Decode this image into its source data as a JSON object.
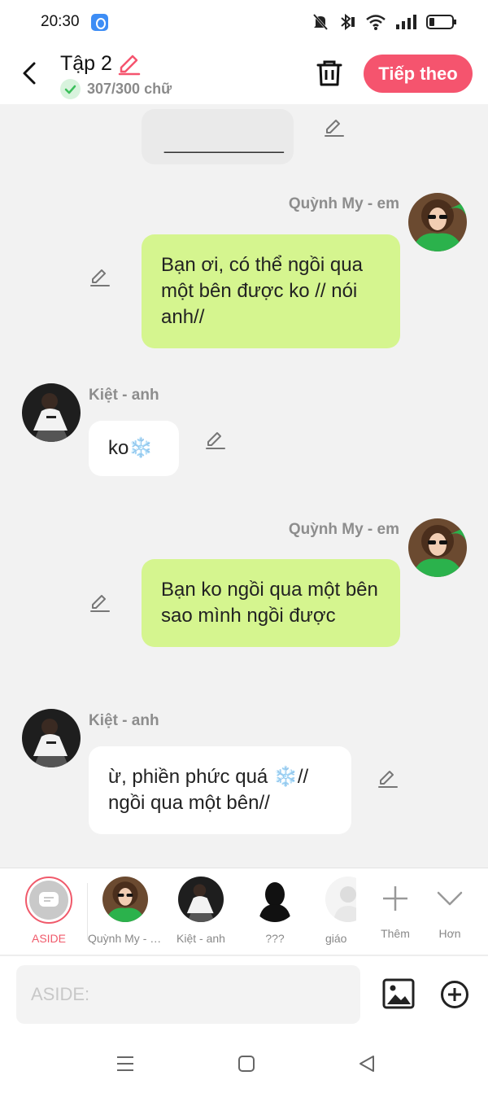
{
  "status_bar": {
    "time": "20:30"
  },
  "header": {
    "title": "Tập 2",
    "word_count": "307/300 chữ",
    "next_label": "Tiếp theo"
  },
  "messages": [
    {
      "side": "left",
      "text": "___________"
    },
    {
      "side": "right",
      "sender": "Quỳnh My - em",
      "text": "Bạn ơi, có thể ngồi qua một bên được ko // nói anh//"
    },
    {
      "side": "left",
      "sender": "Kiệt - anh",
      "text": "ko",
      "emoji": "❄️"
    },
    {
      "side": "right",
      "sender": "Quỳnh My - em",
      "text": "Bạn ko ngồi qua một bên sao mình ngồi được"
    },
    {
      "side": "left",
      "sender": "Kiệt - anh",
      "text_before_emoji": "ừ, phiền phức quá ",
      "emoji": "❄️",
      "text_after_emoji": "//",
      "text_line2": "ngồi qua một bên//"
    }
  ],
  "characters": [
    {
      "label": "ASIDE",
      "selected": true
    },
    {
      "label": "Quỳnh My - em"
    },
    {
      "label": "Kiệt - anh"
    },
    {
      "label": "???"
    },
    {
      "label": "giáo"
    },
    {
      "label": "Thêm"
    },
    {
      "label": "Hơn"
    }
  ],
  "input": {
    "placeholder": "ASIDE:"
  },
  "colors": {
    "accent": "#f5546e",
    "green_bubble": "#d5f58f",
    "background": "#f2f2f2"
  }
}
